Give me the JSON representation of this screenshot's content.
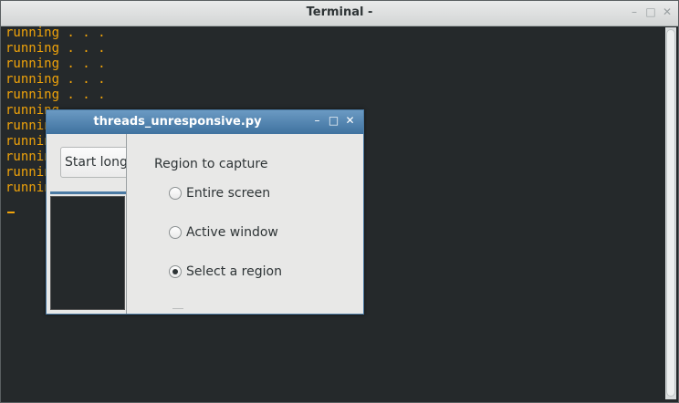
{
  "terminal": {
    "title": "Terminal -",
    "lines": [
      "running . . .",
      "running . . .",
      "running . . .",
      "running . . .",
      "running . . .",
      "running . . .",
      "running . . .",
      "running . . .",
      "running . . .",
      "running . . .",
      "running . . ."
    ],
    "text_color": "#f0a30a",
    "background_color": "#25292b",
    "controls": {
      "minimize": "–",
      "maximize": "□",
      "close": "✕"
    }
  },
  "app": {
    "title": "threads_unresponsive.py",
    "start_button_label": "Start long",
    "region_heading": "Region to capture",
    "options": [
      {
        "label": "Entire screen",
        "checked": false
      },
      {
        "label": "Active window",
        "checked": false
      },
      {
        "label": "Select a region",
        "checked": true
      }
    ],
    "titlebar_color": "#4b7aa3",
    "controls": {
      "minimize": "–",
      "maximize": "□",
      "close": "✕"
    }
  }
}
